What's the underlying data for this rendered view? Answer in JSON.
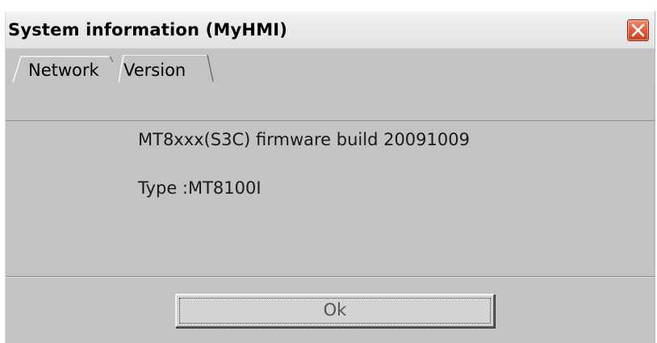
{
  "window": {
    "title": "System information (MyHMI)"
  },
  "tabs": [
    {
      "label": "Network",
      "selected": false
    },
    {
      "label": "Version",
      "selected": true
    }
  ],
  "version_info": {
    "firmware": "MT8xxx(S3C) firmware build 20091009",
    "type": "Type :MT8100I"
  },
  "footer": {
    "ok_label": "Ok"
  },
  "colors": {
    "dialog_background": "#c4c2c4",
    "close_button": "#dd5a39"
  }
}
